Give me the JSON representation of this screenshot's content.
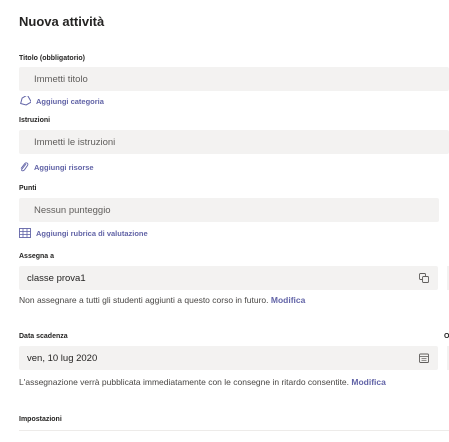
{
  "header": {
    "title": "Nuova attività"
  },
  "form": {
    "title_label": "Titolo (obbligatorio)",
    "title_placeholder": "Immetti titolo",
    "add_category": "Aggiungi categoria",
    "instructions_label": "Istruzioni",
    "instructions_placeholder": "Immetti le istruzioni",
    "add_resources": "Aggiungi risorse",
    "points_label": "Punti",
    "points_placeholder": "Nessun punteggio",
    "add_rubric": "Aggiungi rubrica di valutazione",
    "assign_label": "Assegna a",
    "assign_value": "classe prova1",
    "assign_note": "Non assegnare a tutti gli studenti aggiunti a questo corso in futuro.",
    "assign_note_link": "Modifica",
    "due_label": "Data scadenza",
    "due_value": "ven, 10 lug 2020",
    "due_note": "L'assegnazione verrà pubblicata immediatamente con le consegne in ritardo consentite.",
    "due_note_link": "Modifica",
    "settings_label": "Impostazioni"
  },
  "colors": {
    "accent": "#6264a7",
    "field_bg": "#f3f2f1",
    "text": "#252423"
  },
  "icons": {
    "category": "tag-icon",
    "resources": "paperclip-icon",
    "rubric": "grid-icon",
    "assign": "copy-icon",
    "due": "calendar-icon"
  }
}
